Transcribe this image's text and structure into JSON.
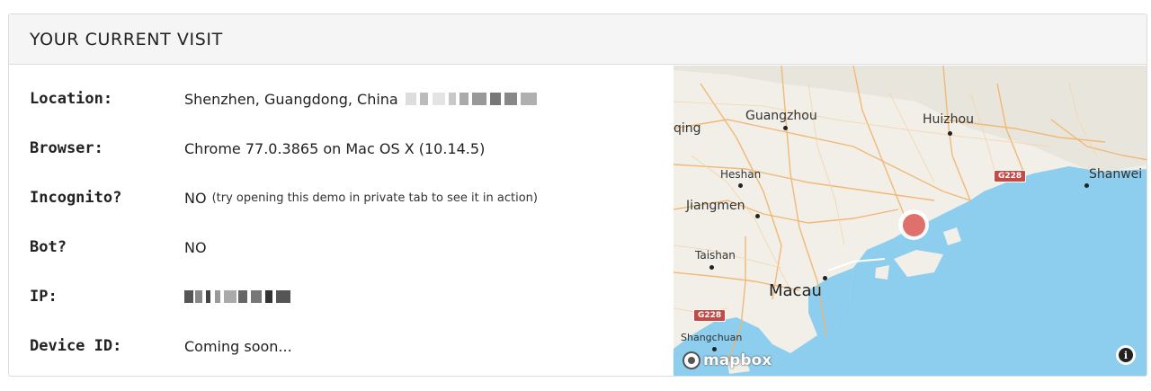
{
  "card": {
    "title": "YOUR CURRENT VISIT"
  },
  "rows": [
    {
      "label": "Location:",
      "value": "Shenzhen, Guangdong, China"
    },
    {
      "label": "Browser:",
      "value": "Chrome 77.0.3865 on Mac OS X (10.14.5)"
    },
    {
      "label": "Incognito?",
      "value": "NO",
      "hint": "(try opening this demo in private tab to see it in action)"
    },
    {
      "label": "Bot?",
      "value": "NO"
    },
    {
      "label": "IP:",
      "value": ""
    },
    {
      "label": "Device ID:",
      "value": "Coming soon..."
    }
  ],
  "map": {
    "cities": {
      "guangzhou": "Guangzhou",
      "huizhou": "Huizhou",
      "qing": "qing",
      "heshan": "Heshan",
      "shanwei": "Shanwei",
      "jiangmen": "Jiangmen",
      "taishan": "Taishan",
      "macau": "Macau",
      "shangchuan": "Shangchuan"
    },
    "shields": {
      "g228_east": "G228",
      "g228_west": "G228"
    },
    "attribution": "mapbox",
    "info_icon": "i",
    "colors": {
      "water": "#8dcdee",
      "land": "#f1efe8",
      "marker": "#e0706c",
      "road": "#f2b36b"
    }
  }
}
